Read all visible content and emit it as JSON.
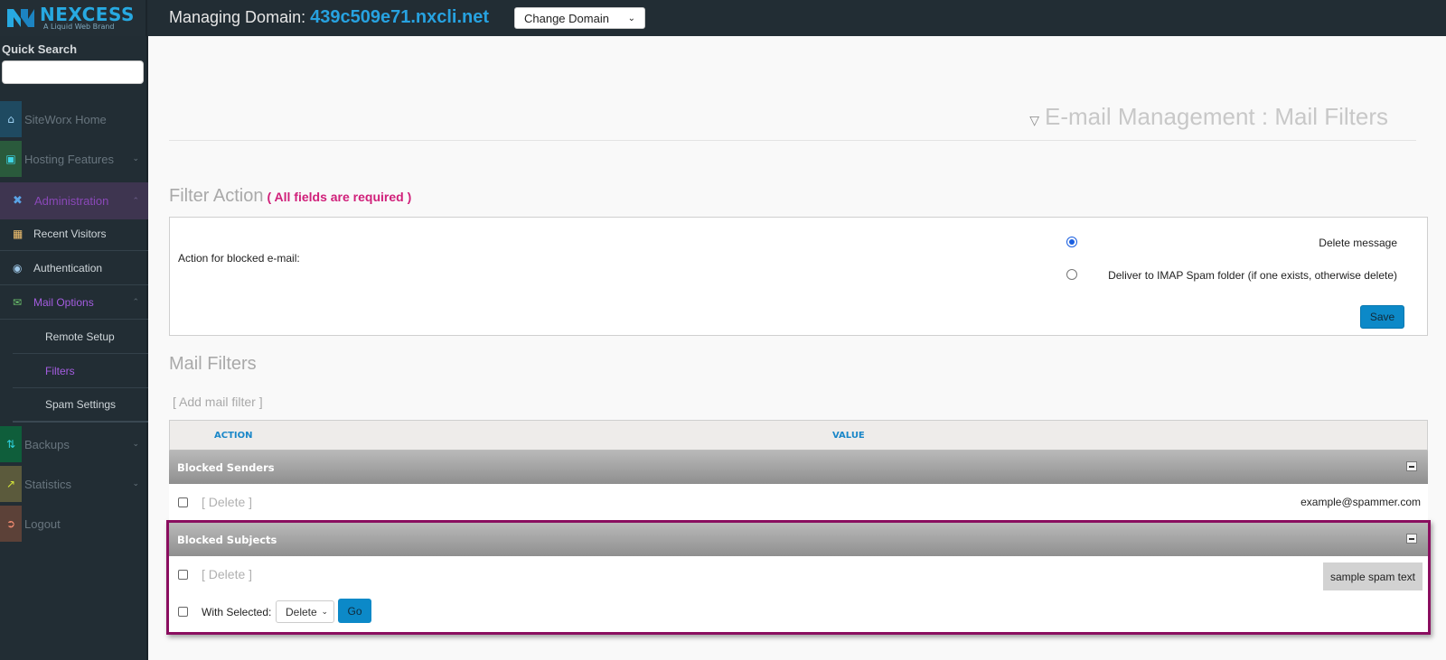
{
  "brand": {
    "name": "NEXCESS",
    "tagline": "A Liquid Web Brand",
    "color": "#27a9e1"
  },
  "header": {
    "managing_label": "Managing Domain:",
    "domain": "439c509e71.nxcli.net",
    "change_domain": {
      "selected": "Change Domain"
    }
  },
  "sidebar": {
    "quick_search_label": "Quick Search",
    "quick_search_value": "",
    "items": [
      {
        "label": "SiteWorx Home",
        "icon": "home-icon",
        "tile": "#1f4a61"
      },
      {
        "label": "Hosting Features",
        "icon": "monitor-icon",
        "tile": "#2a5a3c",
        "expandable": true
      },
      {
        "label": "Administration",
        "icon": "tools-icon",
        "expanded": true,
        "active": true
      },
      {
        "label": "Recent Visitors",
        "icon": "visitors-icon"
      },
      {
        "label": "Authentication",
        "icon": "lock-icon"
      },
      {
        "label": "Mail Options",
        "icon": "mail-globe-icon",
        "expanded": true,
        "active": true
      },
      {
        "label": "Remote Setup"
      },
      {
        "label": "Filters",
        "active": true
      },
      {
        "label": "Spam Settings"
      },
      {
        "label": "Backups",
        "icon": "backup-icon",
        "tile": "#0f5e3b",
        "expandable": true
      },
      {
        "label": "Statistics",
        "icon": "chart-icon",
        "tile": "#5b5a3c",
        "expandable": true
      },
      {
        "label": "Logout",
        "icon": "logout-icon",
        "tile": "#5c4138"
      }
    ]
  },
  "main": {
    "page_title": "E-mail Management : Mail Filters",
    "filter_action": {
      "title": "Filter Action",
      "required_note": "( All fields are required )",
      "field_label": "Action for blocked e-mail:",
      "options": [
        {
          "label": "Delete message",
          "checked": true
        },
        {
          "label": "Deliver to IMAP Spam folder (if one exists, otherwise delete)",
          "checked": false
        }
      ],
      "save_label": "Save"
    },
    "mail_filters": {
      "title": "Mail Filters",
      "add_link": "[ Add mail filter ]",
      "columns": [
        "ACTION",
        "VALUE"
      ],
      "groups": [
        {
          "name": "Blocked Senders",
          "rows": [
            {
              "action": "[ Delete ]",
              "value": "example@spammer.com"
            }
          ]
        },
        {
          "name": "Blocked Subjects",
          "rows": [
            {
              "action": "[ Delete ]",
              "value": "sample spam text"
            }
          ]
        }
      ],
      "with_selected_label": "With Selected:",
      "with_selected_value": "Delete",
      "go_label": "Go"
    }
  }
}
